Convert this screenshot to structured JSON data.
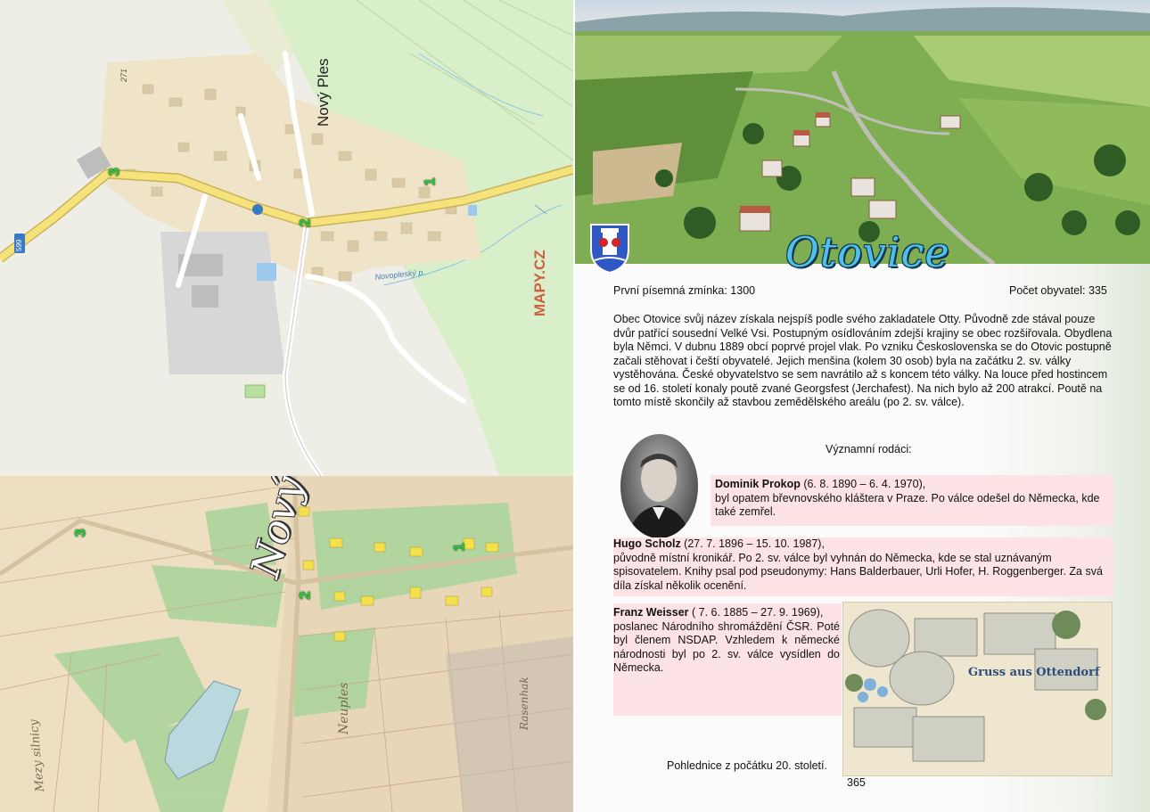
{
  "left": {
    "modern_map": {
      "village_label": "Nový Ples",
      "stream_label": "Novopleský p.",
      "watermark": "MAPY.CZ",
      "road_number": "599",
      "height_label": "271",
      "markers": [
        "1",
        "2",
        "3"
      ]
    },
    "cadastral_map": {
      "title_overlay": "Nový Ples",
      "labels": [
        "Neuples",
        "Mezy silnicy",
        "Rasenhak"
      ],
      "markers": [
        "1",
        "2",
        "3"
      ]
    }
  },
  "right": {
    "town_name": "Otovice",
    "first_mention": "První písemná zmínka: 1300",
    "population": "Počet obyvatel: 335",
    "history": "Obec Otovice svůj název získala nejspíš podle svého zakladatele Otty. Původně zde stával pouze dvůr patřící sousední Velké Vsi. Postupným osídlováním zdejší krajiny se obec rozšiřovala. Obydlena byla Němci. V dubnu 1889 obcí poprvé projel vlak. Po vzniku Československa se do Otovic postupně začali stěhovat i čeští obyvatelé. Jejich menšina (kolem 30 osob) byla na začátku 2. sv. války vystěhována. České obyvatelstvo se sem navrátilo až s koncem této války. Na louce před hostincem se od 16. století konaly poutě zvané Georgsfest (Jerchafest). Na nich bylo až 200 atrakcí. Poutě na tomto místě skončily až stavbou zemědělského areálu (po 2. sv. válce).",
    "notables_heading": "Významní rodáci:",
    "people": [
      {
        "name": "Dominik Prokop",
        "dates": " (6. 8. 1890 – 6. 4. 1970),",
        "bio": "byl opatem břevnovského kláštera v Praze. Po válce odešel do Německa, kde také zemřel."
      },
      {
        "name": "Hugo Scholz",
        "dates": " (27. 7. 1896 – 15. 10. 1987),",
        "bio": "původně místní kronikář. Po 2. sv. válce byl vyhnán do Německa, kde se stal uznávaným spisovatelem. Knihy psal pod pseudonymy: Hans Balderbauer, Urli Hofer, H. Roggenberger. Za svá díla získal několik ocenění."
      },
      {
        "name": "Franz Weisser",
        "dates": " ( 7. 6. 1885 – 27. 9. 1969),",
        "bio": "poslanec Národního shromáždění ČSR. Poté byl členem NSDAP. Vzhledem k německé národnosti byl po 2. sv. válce vysídlen do Německa."
      }
    ],
    "postcard_text": "Gruss aus Ottendorf",
    "postcard_caption": "Pohlednice z počátku 20. století.",
    "page_number": "365"
  },
  "colors": {
    "title_blue": "#4fc0e8",
    "pink_box": "#fde3e6",
    "marker_green": "#2ecc40",
    "road_yellow": "#f6e27a"
  }
}
